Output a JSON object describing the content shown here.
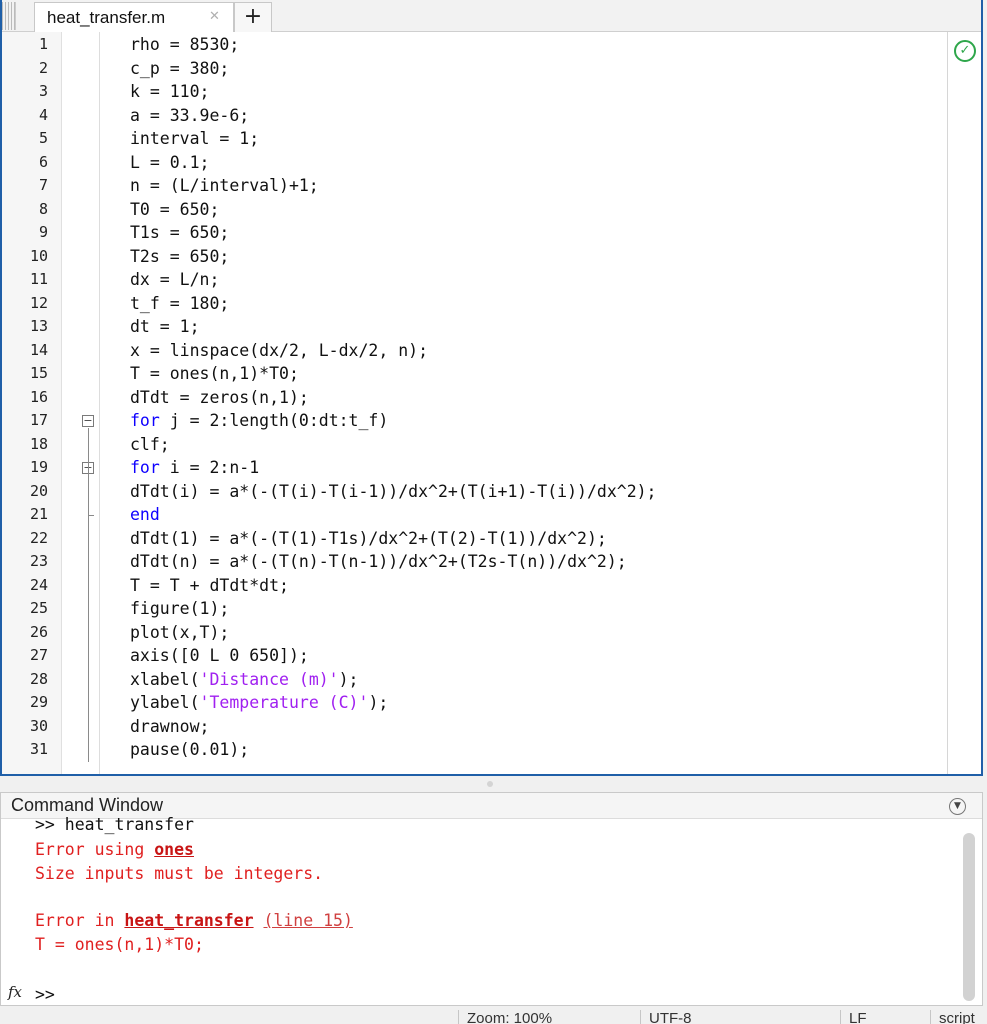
{
  "editor": {
    "tab_name": "heat_transfer.m",
    "close_glyph": "✕",
    "add_tab_glyph": "+",
    "status_icon": "check-icon",
    "lines": [
      {
        "n": "1",
        "segs": [
          {
            "t": "rho = 8530;",
            "c": "n"
          }
        ]
      },
      {
        "n": "2",
        "segs": [
          {
            "t": "c_p = 380;",
            "c": "n"
          }
        ]
      },
      {
        "n": "3",
        "segs": [
          {
            "t": "k = 110;",
            "c": "n"
          }
        ]
      },
      {
        "n": "4",
        "segs": [
          {
            "t": "a = 33.9e-6;",
            "c": "n"
          }
        ]
      },
      {
        "n": "5",
        "segs": [
          {
            "t": "interval = 1;",
            "c": "n"
          }
        ]
      },
      {
        "n": "6",
        "segs": [
          {
            "t": "L = 0.1;",
            "c": "n"
          }
        ]
      },
      {
        "n": "7",
        "segs": [
          {
            "t": "n = (L/interval)+1;",
            "c": "n"
          }
        ]
      },
      {
        "n": "8",
        "segs": [
          {
            "t": "T0 = 650;",
            "c": "n"
          }
        ]
      },
      {
        "n": "9",
        "segs": [
          {
            "t": "T1s = 650;",
            "c": "n"
          }
        ]
      },
      {
        "n": "10",
        "segs": [
          {
            "t": "T2s = 650;",
            "c": "n"
          }
        ]
      },
      {
        "n": "11",
        "segs": [
          {
            "t": "dx = L/n;",
            "c": "n"
          }
        ]
      },
      {
        "n": "12",
        "segs": [
          {
            "t": "t_f = 180;",
            "c": "n"
          }
        ]
      },
      {
        "n": "13",
        "segs": [
          {
            "t": "dt = 1;",
            "c": "n"
          }
        ]
      },
      {
        "n": "14",
        "segs": [
          {
            "t": "x = linspace(dx/2, L-dx/2, n);",
            "c": "n"
          }
        ]
      },
      {
        "n": "15",
        "segs": [
          {
            "t": "T = ones(n,1)*T0;",
            "c": "n"
          }
        ]
      },
      {
        "n": "16",
        "segs": [
          {
            "t": "dTdt = zeros(n,1);",
            "c": "n"
          }
        ]
      },
      {
        "n": "17",
        "segs": [
          {
            "t": "for",
            "c": "kw"
          },
          {
            "t": " j = 2:length(0:dt:t_f)",
            "c": "n"
          }
        ]
      },
      {
        "n": "18",
        "segs": [
          {
            "t": "clf;",
            "c": "n"
          }
        ]
      },
      {
        "n": "19",
        "segs": [
          {
            "t": "for",
            "c": "kw"
          },
          {
            "t": " i = 2:n-1",
            "c": "n"
          }
        ]
      },
      {
        "n": "20",
        "segs": [
          {
            "t": "dTdt(i) = a*(-(T(i)-T(i-1))/dx^2+(T(i+1)-T(i))/dx^2);",
            "c": "n"
          }
        ]
      },
      {
        "n": "21",
        "segs": [
          {
            "t": "end",
            "c": "kw"
          }
        ]
      },
      {
        "n": "22",
        "segs": [
          {
            "t": "dTdt(1) = a*(-(T(1)-T1s)/dx^2+(T(2)-T(1))/dx^2);",
            "c": "n"
          }
        ]
      },
      {
        "n": "23",
        "segs": [
          {
            "t": "dTdt(n) = a*(-(T(n)-T(n-1))/dx^2+(T2s-T(n))/dx^2);",
            "c": "n"
          }
        ]
      },
      {
        "n": "24",
        "segs": [
          {
            "t": "T = T + dTdt*dt;",
            "c": "n"
          }
        ]
      },
      {
        "n": "25",
        "segs": [
          {
            "t": "figure(1);",
            "c": "n"
          }
        ]
      },
      {
        "n": "26",
        "segs": [
          {
            "t": "plot(x,T);",
            "c": "n"
          }
        ]
      },
      {
        "n": "27",
        "segs": [
          {
            "t": "axis([0 L 0 650]);",
            "c": "n"
          }
        ]
      },
      {
        "n": "28",
        "segs": [
          {
            "t": "xlabel(",
            "c": "n"
          },
          {
            "t": "'Distance (m)'",
            "c": "str"
          },
          {
            "t": ");",
            "c": "n"
          }
        ]
      },
      {
        "n": "29",
        "segs": [
          {
            "t": "ylabel(",
            "c": "n"
          },
          {
            "t": "'Temperature (C)'",
            "c": "str"
          },
          {
            "t": ");",
            "c": "n"
          }
        ]
      },
      {
        "n": "30",
        "segs": [
          {
            "t": "drawnow;",
            "c": "n"
          }
        ]
      },
      {
        "n": "31",
        "segs": [
          {
            "t": "pause(0.01);",
            "c": "n"
          }
        ]
      }
    ]
  },
  "command_window": {
    "title": "Command Window",
    "prev_command": ">> heat_transfer",
    "error1_prefix": "Error using ",
    "error1_link": "ones",
    "error1_msg": "Size inputs must be integers.",
    "error2_prefix": "Error in ",
    "error2_link": "heat_transfer",
    "error2_line": "(line 15)",
    "error2_code": "T = ones(n,1)*T0;",
    "fx_label": "fx",
    "prompt": ">>"
  },
  "status_bar": {
    "zoom": "Zoom: 100%",
    "encoding": "UTF-8",
    "eol": "LF",
    "type": "script"
  }
}
